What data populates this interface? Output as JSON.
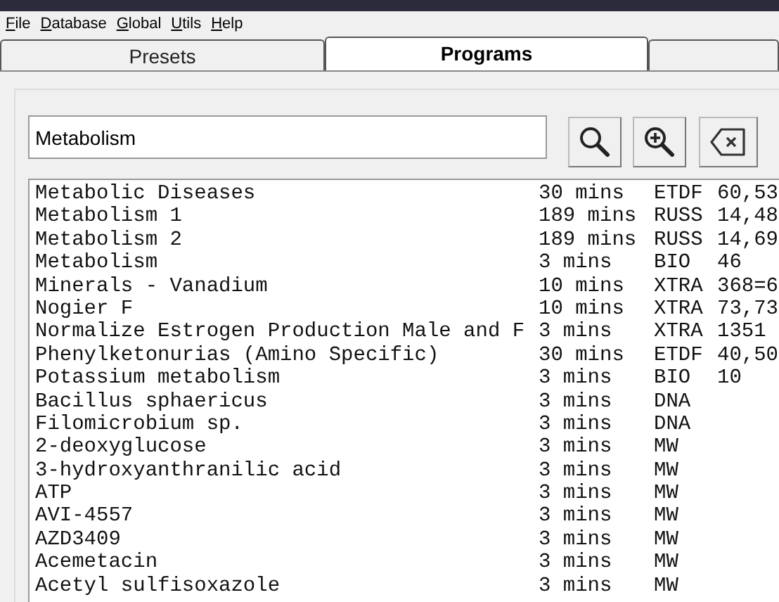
{
  "menu": [
    {
      "label": "File"
    },
    {
      "label": "Database"
    },
    {
      "label": "Global"
    },
    {
      "label": "Utils"
    },
    {
      "label": "Help"
    }
  ],
  "tabs": [
    {
      "label": "Presets",
      "selected": false
    },
    {
      "label": "Programs",
      "selected": true
    },
    {
      "selected": false
    }
  ],
  "search": {
    "value": "Metabolism"
  },
  "programs": [
    {
      "name": "Metabolic Diseases",
      "duration": "30 mins",
      "source": "ETDF",
      "column_4": "60,53"
    },
    {
      "name": "Metabolism 1",
      "duration": "189 mins",
      "source": "RUSS",
      "column_4": "14,48"
    },
    {
      "name": "Metabolism 2",
      "duration": "189 mins",
      "source": "RUSS",
      "column_4": "14,69"
    },
    {
      "name": "Metabolism",
      "duration": "3 mins",
      "source": "BIO",
      "column_4": "46"
    },
    {
      "name": "Minerals - Vanadium",
      "duration": "10 mins",
      "source": "XTRA",
      "column_4": "368=6"
    },
    {
      "name": "Nogier F",
      "duration": "10 mins",
      "source": "XTRA",
      "column_4": "73,73"
    },
    {
      "name": "Normalize Estrogen Production Male and F",
      "duration": "3 mins",
      "source": "XTRA",
      "column_4": "1351"
    },
    {
      "name": "Phenylketonurias (Amino Specific)",
      "duration": "30 mins",
      "source": "ETDF",
      "column_4": "40,50"
    },
    {
      "name": "Potassium metabolism",
      "duration": "3 mins",
      "source": "BIO",
      "column_4": "10"
    },
    {
      "name": "Bacillus sphaericus",
      "duration": "3 mins",
      "source": "DNA"
    },
    {
      "name": "Filomicrobium sp.",
      "duration": "3 mins",
      "source": "DNA"
    },
    {
      "name": "2-deoxyglucose",
      "duration": "3 mins",
      "source": "MW"
    },
    {
      "name": "3-hydroxyanthranilic acid",
      "duration": "3 mins",
      "source": "MW"
    },
    {
      "name": "ATP",
      "duration": "3 mins",
      "source": "MW"
    },
    {
      "name": "AVI-4557",
      "duration": "3 mins",
      "source": "MW"
    },
    {
      "name": "AZD3409",
      "duration": "3 mins",
      "source": "MW"
    },
    {
      "name": "Acemetacin",
      "duration": "3 mins",
      "source": "MW"
    },
    {
      "name": "Acetyl sulfisoxazole",
      "duration": "3 mins",
      "source": "MW"
    }
  ]
}
